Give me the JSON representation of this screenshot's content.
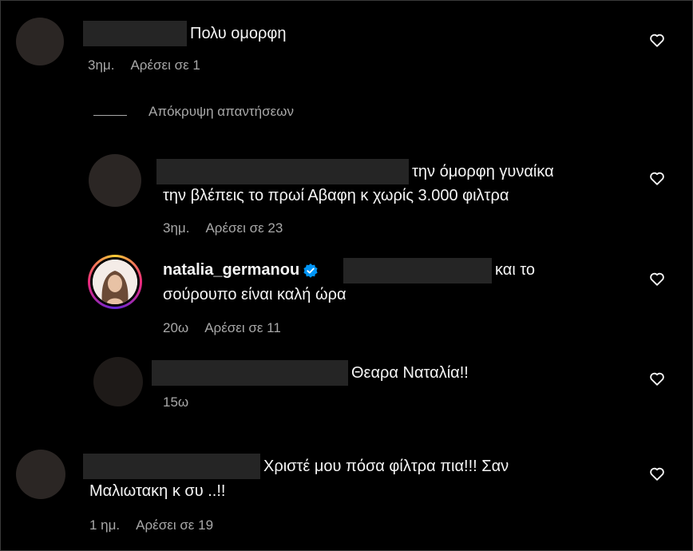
{
  "comments": [
    {
      "text": "Πολυ ομορφη",
      "time": "3ημ.",
      "likes": "Αρέσει σε 1"
    },
    {
      "text_line1": "την όμορφη γυναίκα",
      "text_line2": "την βλέπεις το πρωί Αβαφη κ χωρίς 3.000 φιλτρα",
      "time": "3ημ.",
      "likes": "Αρέσει σε 23"
    },
    {
      "username": "natalia_germanou",
      "text_line1": "και το",
      "text_line2": "σούρουπο είναι καλή ώρα",
      "time": "20ω",
      "likes": "Αρέσει σε 11"
    },
    {
      "text": "Θεαρα Ναταλία!!",
      "time": "15ω"
    },
    {
      "text_line1": "Χριστέ μου πόσα φίλτρα πια!!! Σαν",
      "text_line2": "Μαλιωτακη κ συ ..!!",
      "time": "1 ημ.",
      "likes": "Αρέσει σε 19"
    }
  ],
  "hide_replies_label": "Απόκρυψη απαντήσεων",
  "colors": {
    "background": "#000000",
    "text": "#f5f5f5",
    "secondary": "#a8a8a8",
    "verified": "#0095f6",
    "redaction": "#252525"
  }
}
